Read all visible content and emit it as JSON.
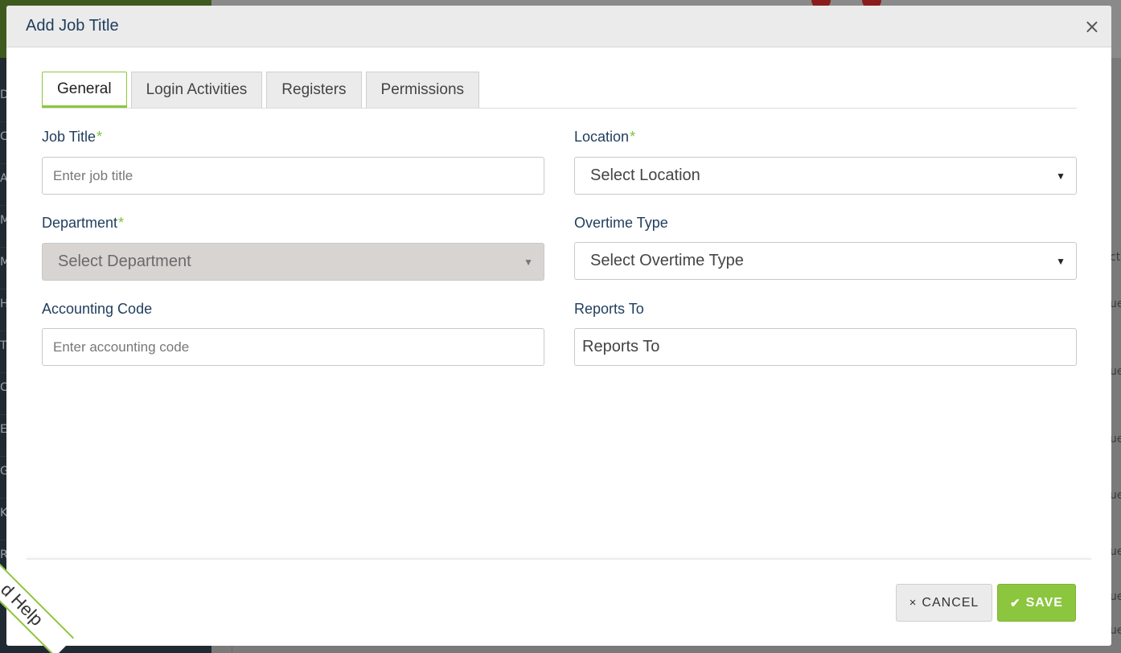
{
  "background": {
    "sidebar_letters": [
      "D",
      "C",
      "A",
      "M",
      "M",
      "H",
      "T",
      "C",
      "E",
      "G",
      "K",
      "R"
    ],
    "right_fragments": [
      "ct",
      "ue",
      "ue",
      "ue",
      "ue",
      "ue",
      "ue",
      "ue"
    ]
  },
  "help_ribbon": {
    "label": "d Help"
  },
  "modal": {
    "title": "Add Job Title",
    "close_icon": "×",
    "tabs": [
      {
        "label": "General",
        "active": true
      },
      {
        "label": "Login Activities",
        "active": false
      },
      {
        "label": "Registers",
        "active": false
      },
      {
        "label": "Permissions",
        "active": false
      }
    ],
    "fields": {
      "job_title": {
        "label": "Job Title",
        "required": "*",
        "placeholder": "Enter job title",
        "value": ""
      },
      "location": {
        "label": "Location",
        "required": "*",
        "selected": "Select Location"
      },
      "department": {
        "label": "Department",
        "required": "*",
        "selected": "Select Department",
        "disabled": true
      },
      "overtime_type": {
        "label": "Overtime Type",
        "selected": "Select Overtime Type"
      },
      "accounting_code": {
        "label": "Accounting Code",
        "placeholder": "Enter accounting code",
        "value": ""
      },
      "reports_to": {
        "label": "Reports To",
        "value": "Reports To"
      }
    },
    "buttons": {
      "cancel": {
        "label": "CANCEL",
        "icon": "×"
      },
      "save": {
        "label": "SAVE",
        "icon": "✔"
      }
    }
  },
  "colors": {
    "accent_green": "#8cc63f",
    "title_blue": "#1e3d5c",
    "required_green": "#7cc23a"
  }
}
